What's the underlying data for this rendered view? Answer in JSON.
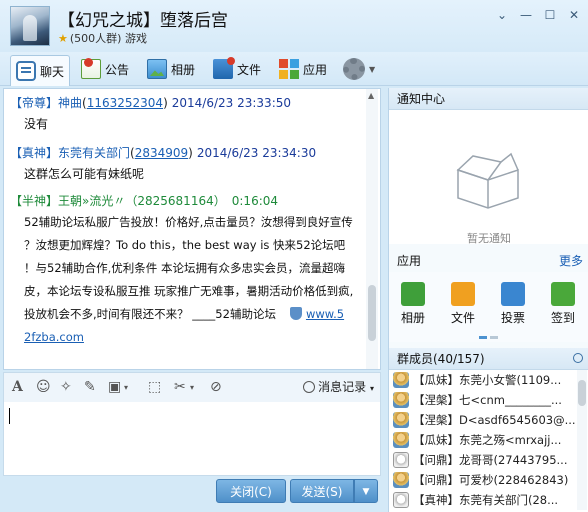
{
  "header": {
    "title": "【幻咒之城】堕落后宫",
    "member_count": "(500人群)",
    "category": "游戏"
  },
  "window_controls": [
    "⌄",
    "—",
    "☐",
    "✕"
  ],
  "toolbar": {
    "tabs": [
      {
        "label": "聊天",
        "icon": "chat-icon"
      },
      {
        "label": "公告",
        "icon": "notice-icon"
      },
      {
        "label": "相册",
        "icon": "album-icon"
      },
      {
        "label": "文件",
        "icon": "file-icon"
      },
      {
        "label": "应用",
        "icon": "apps-icon"
      }
    ]
  },
  "chat": {
    "messages": [
      {
        "role": "【帝尊】",
        "sender": "神曲",
        "uid": "1163252304",
        "time": "2014/6/23 23:33:50",
        "text": "没有",
        "role_color": "#1a5fb4"
      },
      {
        "role": "【真神】",
        "sender": "东莞有关部门",
        "uid": "2834909",
        "time": "2014/6/23 23:34:30",
        "text": "这群怎么可能有妹纸呢",
        "role_color": "#1a5fb4"
      },
      {
        "role": "【半神】",
        "sender": "王朝»流光〃",
        "uid": "2825681164",
        "time": "0:16:04",
        "role_color": "#1e8a3a"
      }
    ],
    "ad_lines": [
      "52辅助论坛私服广告投放！价格好,点击量员？汝想得到良好宣传",
      "？汝想更加辉煌？To do this，the best way is 快来52论坛吧",
      "！与52辅助合作,优利条件 本论坛拥有众多忠实会员，流量超嗨",
      "皮，本论坛专设私服互推 玩家推广无难事，暑期活动价格低到疯,",
      "投放机会不多,时间有限还不来？ ____52辅助论坛"
    ],
    "ad_link_1": "www.5",
    "ad_link_2": "2fzba.com"
  },
  "input_toolbar": {
    "icons": [
      "font-icon",
      "emoji-icon",
      "magic-icon",
      "edit-icon",
      "image-icon",
      "screenshot-icon",
      "scissors-icon",
      "voice-off-icon"
    ],
    "history_label": "消息记录"
  },
  "buttons": {
    "close_label": "关闭(C)",
    "send_label": "发送(S)"
  },
  "notice_center": {
    "title": "通知中心",
    "empty_text": "暂无通知"
  },
  "apps": {
    "title": "应用",
    "more": "更多",
    "items": [
      {
        "label": "相册",
        "color": "#3f9f3a"
      },
      {
        "label": "文件",
        "color": "#f0a020"
      },
      {
        "label": "投票",
        "color": "#3a86d0"
      },
      {
        "label": "签到",
        "color": "#4aa83a"
      }
    ]
  },
  "members": {
    "title": "群成员(40/157)",
    "list": [
      {
        "text": "【瓜妹】东莞小女警(1109...",
        "avatar": "user"
      },
      {
        "text": "【涅槃】七<cnm________...",
        "avatar": "user"
      },
      {
        "text": "【涅槃】D<asdf6545603@...",
        "avatar": "user"
      },
      {
        "text": "【瓜妹】东莞之殇<mrxajj...",
        "avatar": "user"
      },
      {
        "text": "【问鼎】龙哥哥(27443795...",
        "avatar": "bear"
      },
      {
        "text": "【问鼎】可爱杪(228462843)",
        "avatar": "user"
      },
      {
        "text": "【真神】东莞有关部门(28...",
        "avatar": "bear"
      }
    ]
  }
}
